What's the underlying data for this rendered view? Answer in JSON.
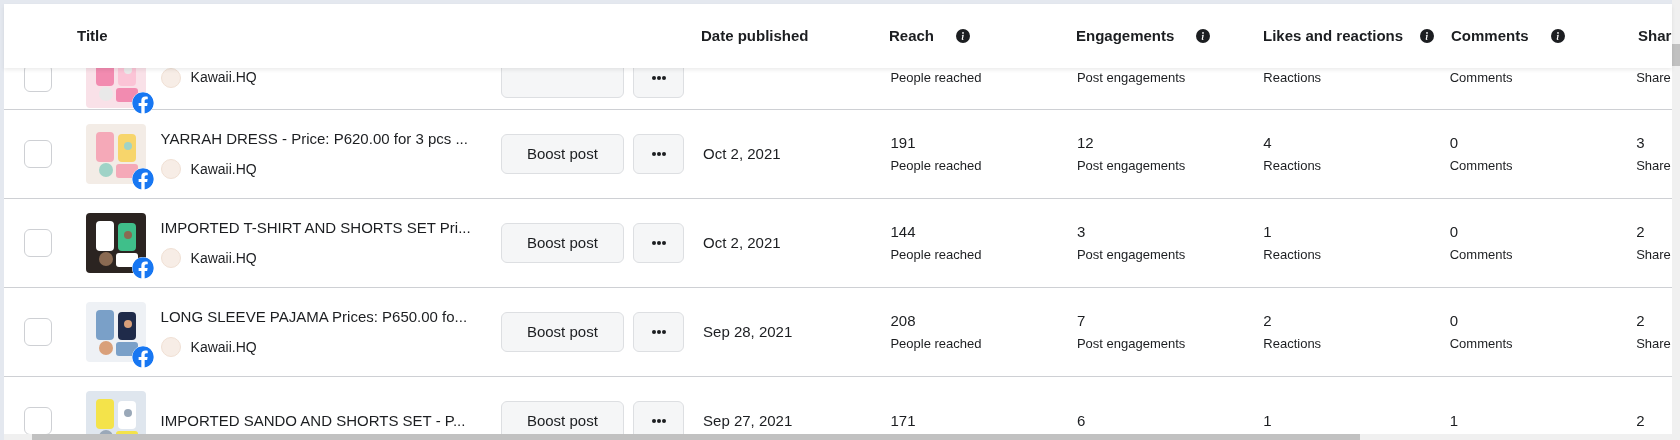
{
  "table": {
    "columns": [
      {
        "label": "Title",
        "info": false
      },
      {
        "label": "Date published",
        "info": false
      },
      {
        "label": "Reach",
        "info": true
      },
      {
        "label": "Engagements",
        "info": true
      },
      {
        "label": "Likes and reactions",
        "info": true
      },
      {
        "label": "Comments",
        "info": true
      },
      {
        "label": "Shar",
        "info": false
      }
    ],
    "rows": [
      {
        "checked": false,
        "page": "Kawaii.HQ",
        "metrics": [
          {
            "label": "People reached"
          },
          {
            "label": "Post engagements"
          },
          {
            "label": "Reactions"
          },
          {
            "label": "Comments"
          },
          {
            "label": "Share"
          }
        ]
      },
      {
        "checked": false,
        "title": "YARRAH DRESS - Price: P620.00 for 3 pcs ...",
        "page": "Kawaii.HQ",
        "boost": "Boost post",
        "date": "Oct 2, 2021",
        "metrics": [
          {
            "value": "191",
            "label": "People reached"
          },
          {
            "value": "12",
            "label": "Post engagements"
          },
          {
            "value": "4",
            "label": "Reactions"
          },
          {
            "value": "0",
            "label": "Comments"
          },
          {
            "value": "3",
            "label": "Share"
          }
        ]
      },
      {
        "checked": false,
        "title": "IMPORTED T-SHIRT AND SHORTS SET Pri...",
        "page": "Kawaii.HQ",
        "boost": "Boost post",
        "date": "Oct 2, 2021",
        "metrics": [
          {
            "value": "144",
            "label": "People reached"
          },
          {
            "value": "3",
            "label": "Post engagements"
          },
          {
            "value": "1",
            "label": "Reactions"
          },
          {
            "value": "0",
            "label": "Comments"
          },
          {
            "value": "2",
            "label": "Share"
          }
        ]
      },
      {
        "checked": false,
        "title": "LONG SLEEVE PAJAMA Prices: P650.00 fo...",
        "page": "Kawaii.HQ",
        "boost": "Boost post",
        "date": "Sep 28, 2021",
        "metrics": [
          {
            "value": "208",
            "label": "People reached"
          },
          {
            "value": "7",
            "label": "Post engagements"
          },
          {
            "value": "2",
            "label": "Reactions"
          },
          {
            "value": "0",
            "label": "Comments"
          },
          {
            "value": "2",
            "label": "Share"
          }
        ]
      },
      {
        "checked": false,
        "title": "IMPORTED SANDO AND SHORTS SET - P...",
        "boost": "Boost post",
        "date": "Sep 27, 2021",
        "metrics": [
          {
            "value": "171"
          },
          {
            "value": "6"
          },
          {
            "value": "1"
          },
          {
            "value": "1"
          },
          {
            "value": "2"
          }
        ]
      }
    ]
  }
}
